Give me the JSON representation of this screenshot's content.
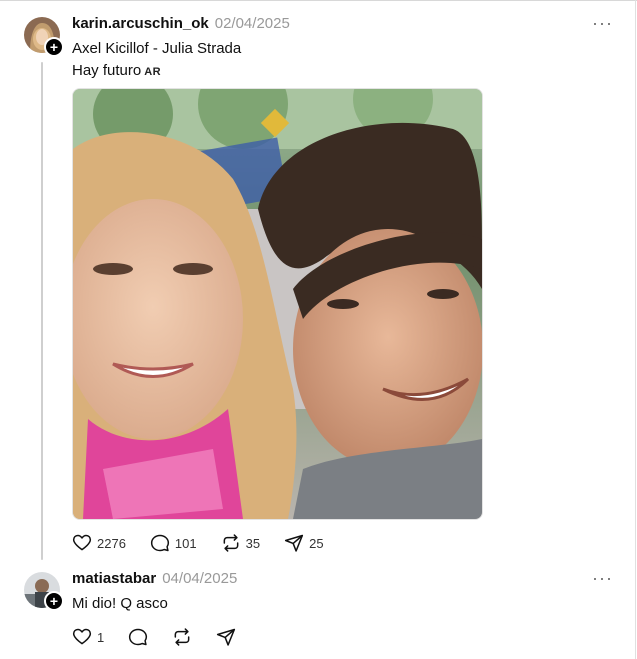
{
  "posts": [
    {
      "username": "karin.arcuschin_ok",
      "timestamp": "02/04/2025",
      "lines": [
        "Axel Kicillof - Julia Strada",
        "Hay futuro"
      ],
      "flag": "AR",
      "more": "···",
      "actions": {
        "likes": "2276",
        "comments": "101",
        "reposts": "35",
        "shares": "25"
      }
    },
    {
      "username": "matiastabar",
      "timestamp": "04/04/2025",
      "lines": [
        "Mi dio! Q asco"
      ],
      "more": "···",
      "actions": {
        "likes": "1"
      }
    }
  ],
  "icons": {
    "like": "heart-icon",
    "comment": "comment-bubble-icon",
    "repost": "repost-arrows-icon",
    "share": "send-plane-icon",
    "more": "more-dots-icon",
    "follow": "plus-icon"
  },
  "colors": {
    "text": "#101010",
    "muted": "#999999",
    "thread": "#cfcfcf"
  }
}
